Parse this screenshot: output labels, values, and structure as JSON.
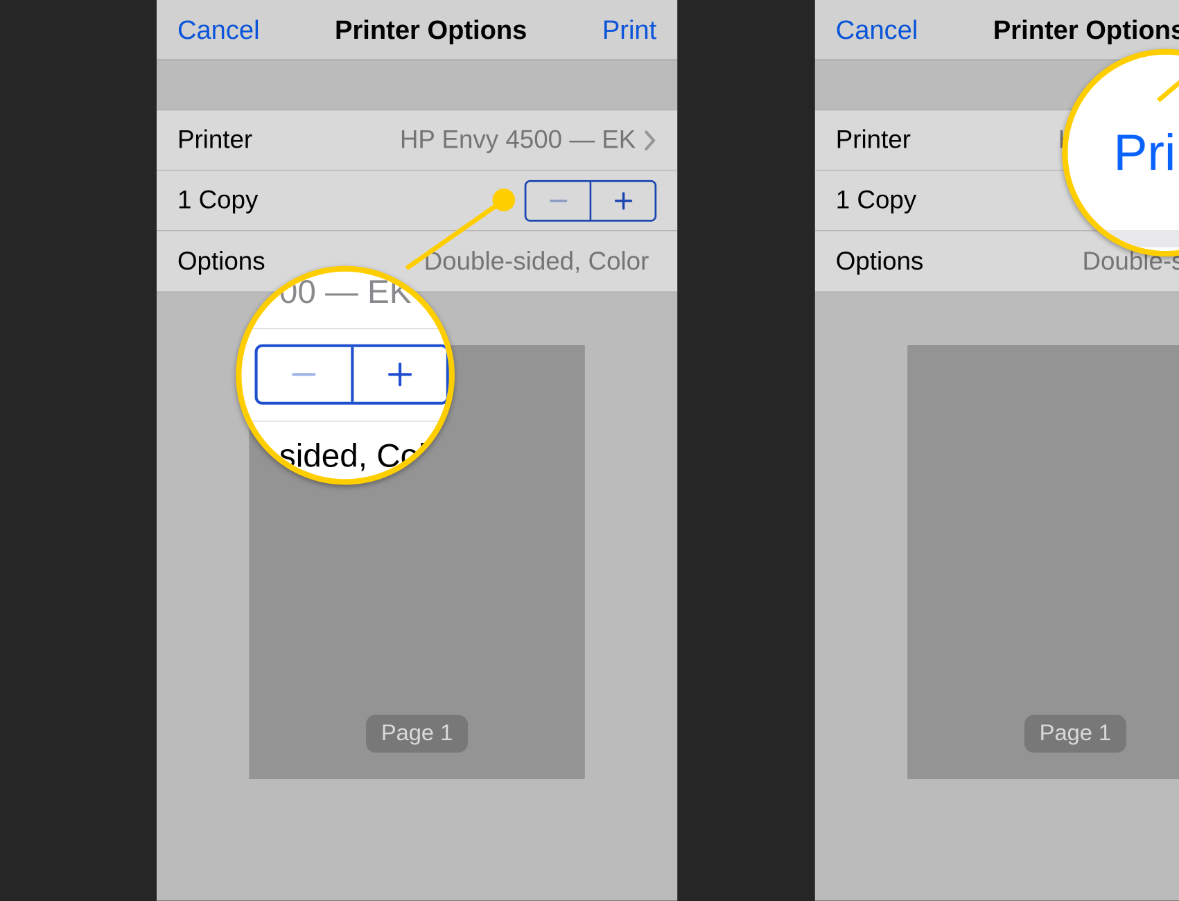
{
  "nav": {
    "cancel": "Cancel",
    "title": "Printer Options",
    "print": "Print"
  },
  "rows": {
    "printer_label": "Printer",
    "printer_value": "HP Envy 4500 — EK",
    "copies_label": "1 Copy",
    "options_label": "Options",
    "options_value": "Double-sided, Color"
  },
  "preview": {
    "page_label": "Page 1"
  },
  "magnifiers": {
    "left_top_text": "00 — EK",
    "left_bottom_text": "sided, Col",
    "right_text": "Print"
  }
}
